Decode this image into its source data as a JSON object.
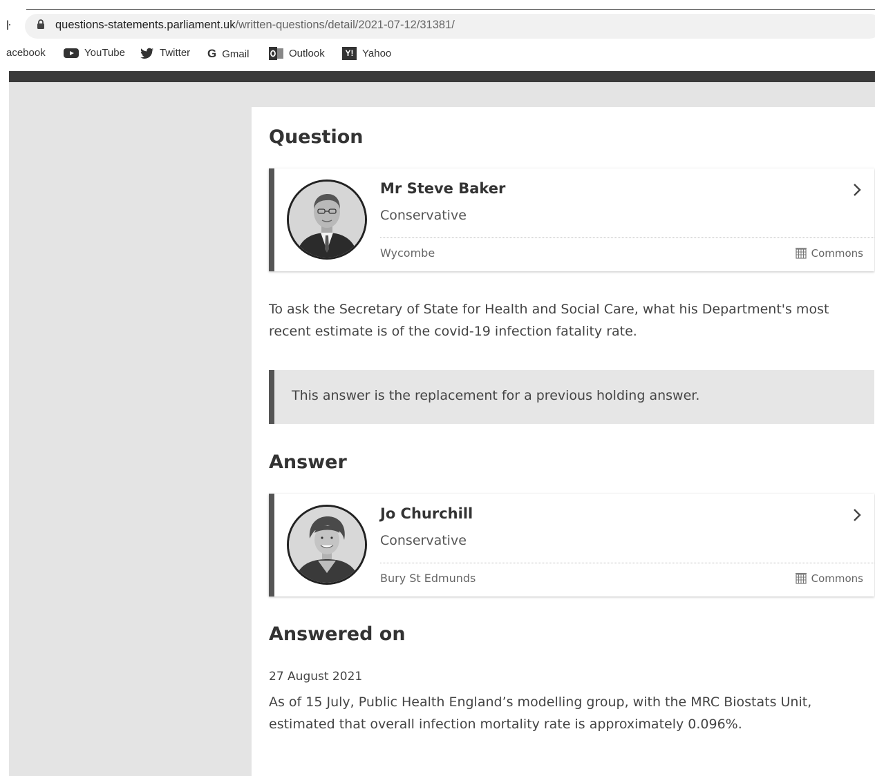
{
  "browser": {
    "nav_fragment": "ŀ",
    "url_domain": "questions-statements.parliament.uk",
    "url_path": "/written-questions/detail/2021-07-12/31381/",
    "bookmarks": [
      {
        "label": "acebook",
        "icon": "facebook-icon"
      },
      {
        "label": "YouTube",
        "icon": "youtube-icon"
      },
      {
        "label": "Twitter",
        "icon": "twitter-icon"
      },
      {
        "label": "Gmail",
        "icon": "google-icon"
      },
      {
        "label": "Outlook",
        "icon": "outlook-icon"
      },
      {
        "label": "Yahoo",
        "icon": "yahoo-icon"
      }
    ]
  },
  "question": {
    "heading": "Question",
    "member": {
      "name": "Mr Steve Baker",
      "party": "Conservative",
      "constituency": "Wycombe",
      "house": "Commons"
    },
    "text": "To ask the Secretary of State for Health and Social Care, what his Department's most recent estimate is of the covid-19 infection fatality rate."
  },
  "notice": "This answer is the replacement for a previous holding answer.",
  "answer": {
    "heading": "Answer",
    "member": {
      "name": "Jo Churchill",
      "party": "Conservative",
      "constituency": "Bury St Edmunds",
      "house": "Commons"
    }
  },
  "answered_on": {
    "heading": "Answered on",
    "date": "27 August 2021",
    "text": "As of 15 July, Public Health England’s modelling group, with the MRC Biostats Unit, estimated that overall infection mortality rate is approximately 0.096%."
  },
  "colors": {
    "page_background": "#e4e4e4",
    "accent_border": "#555555",
    "dark_bar": "#3a3a3a"
  }
}
